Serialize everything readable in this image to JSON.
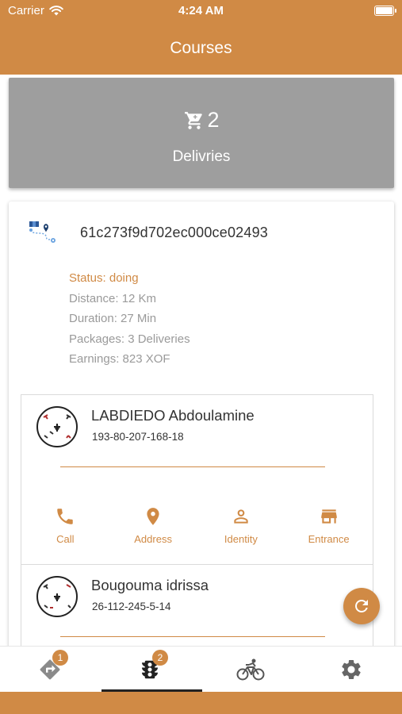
{
  "status_bar": {
    "carrier": "Carrier",
    "time": "4:24 AM"
  },
  "header": {
    "title": "Courses"
  },
  "summary": {
    "count": "2",
    "label": "Delivries",
    "icon": "cart-icon"
  },
  "course": {
    "id": "61c273f9d702ec000ce02493",
    "status": "Status: doing",
    "distance": "Distance: 12 Km",
    "duration": "Duration: 27 Min",
    "packages": "Packages: 3 Deliveries",
    "earnings": "Earnings: 823 XOF"
  },
  "clients": [
    {
      "name": "LABDIEDO Abdoulamine",
      "phone": "193-80-207-168-18",
      "actions": {
        "call": "Call",
        "address": "Address",
        "identity": "Identity",
        "entrance": "Entrance"
      }
    },
    {
      "name": "Bougouma idrissa",
      "phone": "26-112-245-5-14"
    }
  ],
  "tabs": [
    {
      "icon": "directions-icon",
      "badge": "1"
    },
    {
      "icon": "traffic-light-icon",
      "badge": "2"
    },
    {
      "icon": "bicycle-icon"
    },
    {
      "icon": "gear-icon"
    }
  ],
  "colors": {
    "accent": "#d08a45",
    "summary_bg": "#9e9e9e",
    "muted_text": "#9a9a9a"
  }
}
